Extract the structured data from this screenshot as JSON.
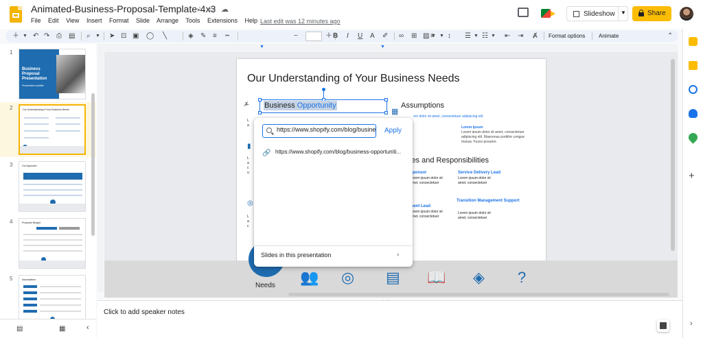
{
  "header": {
    "doc_title": "Animated-Business-Proposal-Template-4x3",
    "menus": [
      "File",
      "Edit",
      "View",
      "Insert",
      "Format",
      "Slide",
      "Arrange",
      "Tools",
      "Extensions",
      "Help"
    ],
    "last_edit": "Last edit was 12 minutes ago",
    "slideshow_label": "Slideshow",
    "share_label": "Share"
  },
  "toolbar": {
    "format_options": "Format options",
    "animate": "Animate",
    "font_size": ""
  },
  "filmstrip": {
    "slides": [
      {
        "num": "1",
        "title": "Business Proposal Presentation",
        "subtitle": "Presentation subtitle"
      },
      {
        "num": "2",
        "title": "Our Understanding of Your Business Needs"
      },
      {
        "num": "3",
        "title": "Our Approach"
      },
      {
        "num": "4",
        "title": "Proposed Budget"
      },
      {
        "num": "5",
        "title": "Assumptions"
      }
    ]
  },
  "slide": {
    "title": "Our Understanding of Your Business Needs",
    "selected_text_plain": "Business ",
    "selected_text_link": "Opportunity",
    "assumptions": "Assumptions",
    "lorem_line": "em dolor sit amet, consectetuer adipiscing elit.",
    "lorem_head": "Lorem Ipsum",
    "lorem_body": "Lorem ipsum dolor sit amet, consectetuer adipiscing elit. Maecenas porttitor congue massa. Fusce posuere.",
    "roles_head": "les and Responsibilities",
    "role_sponsor": "ponsor",
    "role_service": "Service Delivery Lead",
    "role_mgmt": "ment Lead",
    "role_transition": "Transition Management Support",
    "role_body": "Lorem ipsum dolor sit amet, consectetuer",
    "needs": "Needs"
  },
  "link_popup": {
    "input_value": "https://www.shopify.com/blog/business-opportunities",
    "apply": "Apply",
    "suggestion": "https://www.shopify.com/blog/business-opportuniti...",
    "slides_link": "Slides in this presentation"
  },
  "notes": {
    "placeholder": "Click to add speaker notes"
  },
  "colors": {
    "accent": "#1a73e8",
    "share": "#fbbc04",
    "brand_blue": "#1f6cb0"
  }
}
